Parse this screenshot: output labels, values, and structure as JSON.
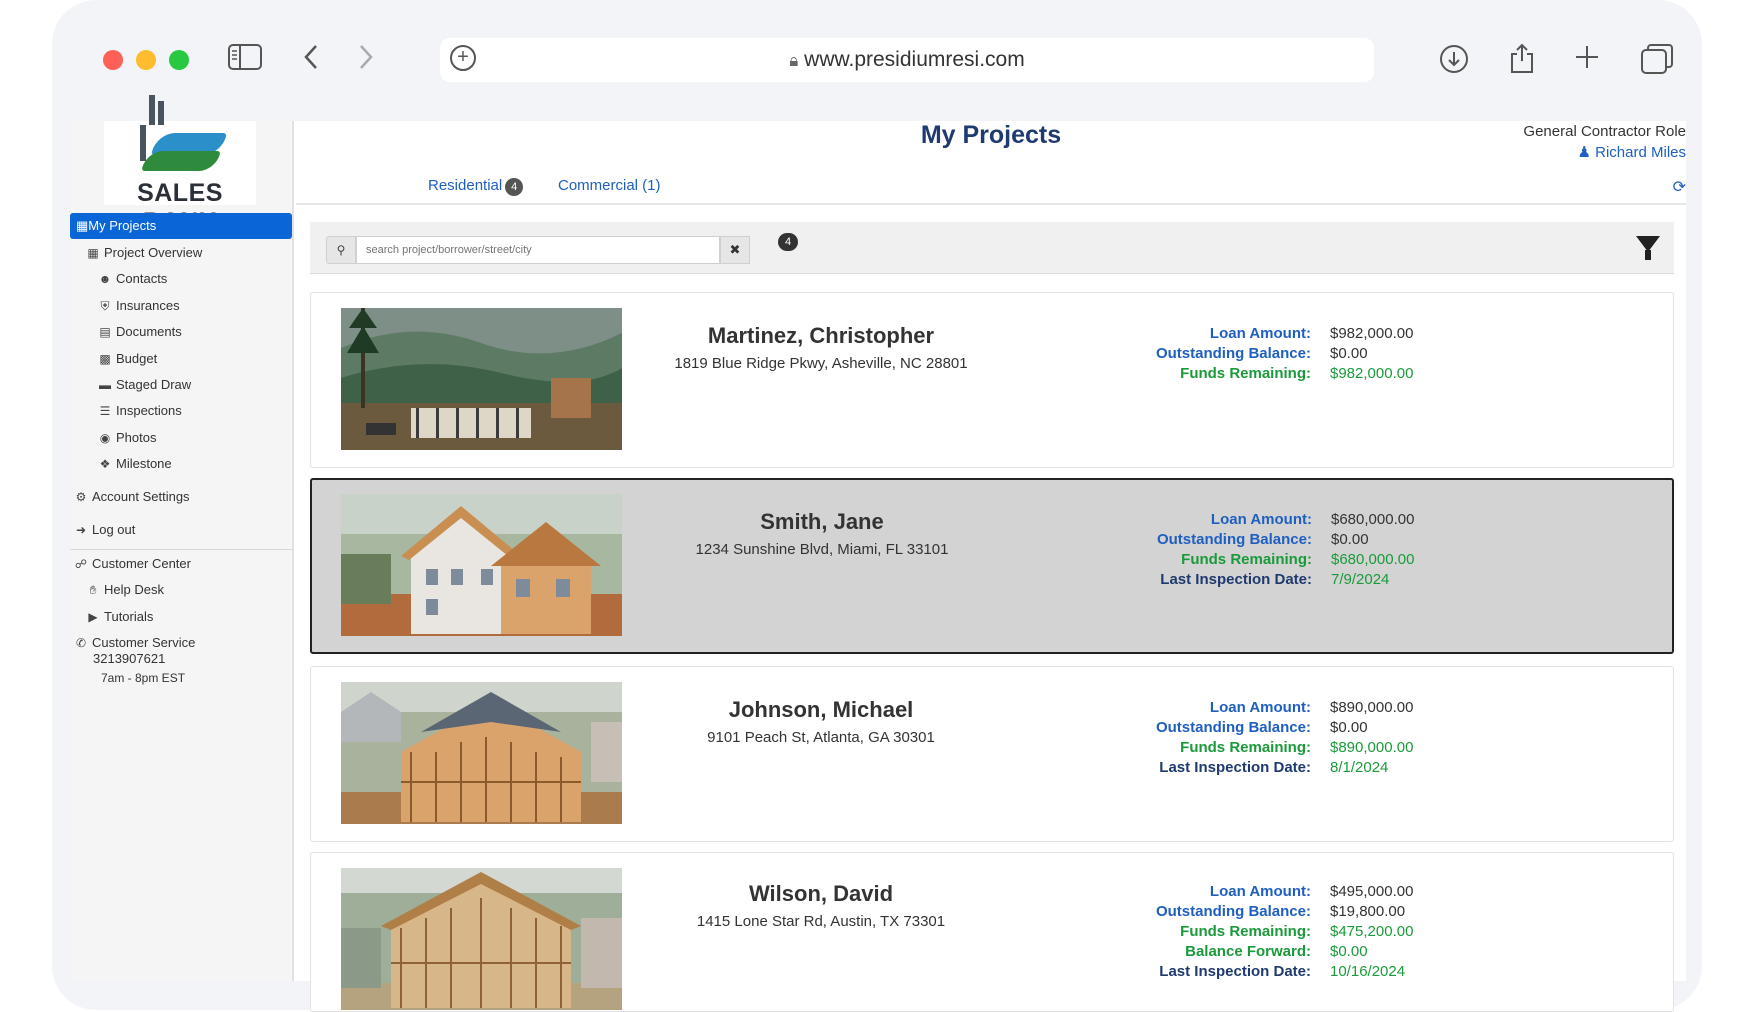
{
  "browser": {
    "url": "www.presidiumresi.com"
  },
  "sidebar": {
    "logo_text": "SALES BANK",
    "active_item": "My Projects",
    "sub_items": [
      {
        "label": "Project Overview",
        "icon": "grid-icon"
      },
      {
        "label": "Contacts",
        "icon": "users-icon"
      },
      {
        "label": "Insurances",
        "icon": "shield-icon"
      },
      {
        "label": "Documents",
        "icon": "file-icon"
      },
      {
        "label": "Budget",
        "icon": "calculator-icon"
      },
      {
        "label": "Staged Draw",
        "icon": "card-icon"
      },
      {
        "label": "Inspections",
        "icon": "list-icon"
      },
      {
        "label": "Photos",
        "icon": "camera-icon"
      },
      {
        "label": "Milestone",
        "icon": "cubes-icon"
      }
    ],
    "account_settings": "Account Settings",
    "logout": "Log out",
    "customer_center": "Customer Center",
    "help_desk": "Help Desk",
    "tutorials": "Tutorials",
    "customer_service": "Customer Service",
    "phone": "3213907621",
    "hours": "7am - 8pm EST"
  },
  "header": {
    "title": "My Projects",
    "role": "General Contractor Role",
    "user": "Richard Miles"
  },
  "tabs": {
    "residential": "Residential",
    "residential_count": "4",
    "commercial": "Commercial (1)"
  },
  "search": {
    "placeholder": "search project/borrower/street/city",
    "result_count": "4"
  },
  "projects": [
    {
      "name": "Martinez, Christopher",
      "address": "1819 Blue Ridge Pkwy, Asheville, NC 28801",
      "loan_label": "Loan Amount:",
      "loan": "$982,000.00",
      "outstanding_label": "Outstanding Balance:",
      "outstanding": "$0.00",
      "funds_label": "Funds Remaining:",
      "funds": "$982,000.00"
    },
    {
      "name": "Smith, Jane",
      "address": "1234 Sunshine Blvd, Miami, FL 33101",
      "loan_label": "Loan Amount:",
      "loan": "$680,000.00",
      "outstanding_label": "Outstanding Balance:",
      "outstanding": "$0.00",
      "funds_label": "Funds Remaining:",
      "funds": "$680,000.00",
      "inspection_label": "Last Inspection Date:",
      "inspection": "7/9/2024"
    },
    {
      "name": "Johnson, Michael",
      "address": "9101 Peach St, Atlanta, GA 30301",
      "loan_label": "Loan Amount:",
      "loan": "$890,000.00",
      "outstanding_label": "Outstanding Balance:",
      "outstanding": "$0.00",
      "funds_label": "Funds Remaining:",
      "funds": "$890,000.00",
      "inspection_label": "Last Inspection Date:",
      "inspection": "8/1/2024"
    },
    {
      "name": "Wilson, David",
      "address": "1415 Lone Star Rd, Austin, TX 73301",
      "loan_label": "Loan Amount:",
      "loan": "$495,000.00",
      "outstanding_label": "Outstanding Balance:",
      "outstanding": "$19,800.00",
      "funds_label": "Funds Remaining:",
      "funds": "$475,200.00",
      "forward_label": "Balance Forward:",
      "forward": "$0.00",
      "inspection_label": "Last Inspection Date:",
      "inspection": "10/16/2024"
    }
  ]
}
